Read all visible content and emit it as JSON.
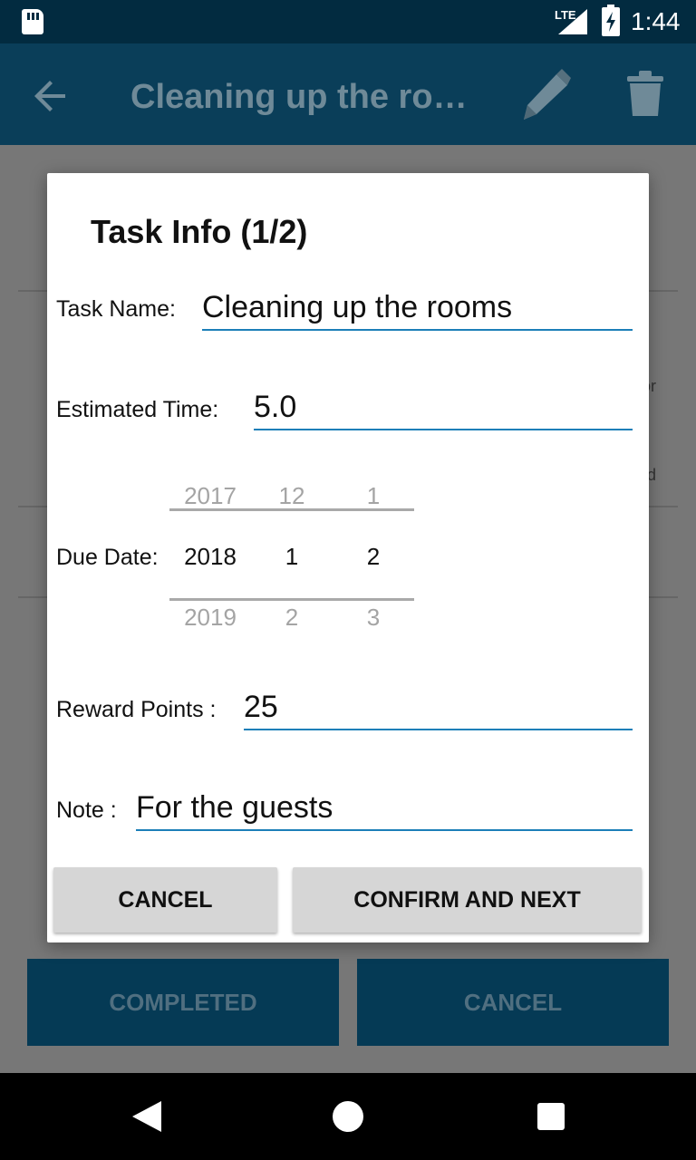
{
  "status_bar": {
    "network": "LTE",
    "time": "1:44"
  },
  "app_bar": {
    "title": "Cleaning up the roo…"
  },
  "background": {
    "fragments": [
      "or",
      "d"
    ],
    "buttons": {
      "completed": "COMPLETED",
      "cancel": "CANCEL"
    }
  },
  "dialog": {
    "title": "Task Info (1/2)",
    "task_name": {
      "label": "Task Name:",
      "value": "Cleaning up the rooms"
    },
    "estimated_time": {
      "label": "Estimated Time:",
      "value": "5.0"
    },
    "due_date": {
      "label": "Due Date:",
      "year": {
        "prev": "2017",
        "selected": "2018",
        "next": "2019"
      },
      "month": {
        "prev": "12",
        "selected": "1",
        "next": "2"
      },
      "day": {
        "prev": "1",
        "selected": "2",
        "next": "3"
      }
    },
    "reward_points": {
      "label": "Reward Points :",
      "value": "25"
    },
    "note": {
      "label": "Note :",
      "value": "For the guests"
    },
    "buttons": {
      "cancel": "CANCEL",
      "confirm": "CONFIRM AND NEXT"
    }
  },
  "colors": {
    "status_bar": "#022b40",
    "app_bar_dimmed": "#0a3e59",
    "input_underline": "#1c7fb8",
    "dialog_button": "#d6d6d6"
  },
  "icons": [
    "sd-card-icon",
    "signal-icon",
    "battery-charging-icon",
    "back-arrow-icon",
    "pencil-icon",
    "trash-icon",
    "nav-back-icon",
    "nav-home-icon",
    "nav-recents-icon"
  ]
}
